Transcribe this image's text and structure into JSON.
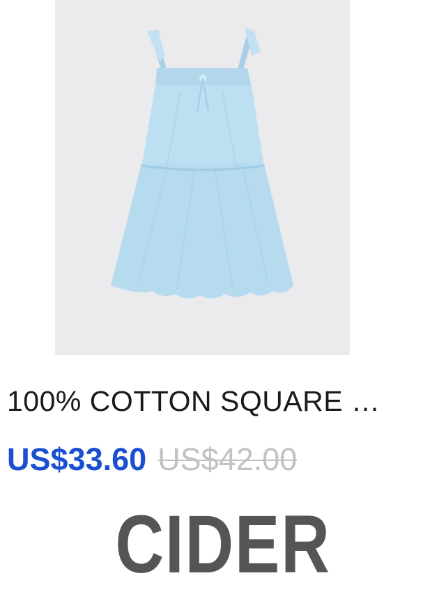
{
  "product": {
    "image_alt": "light blue tiered cotton square neck dress with tie straps",
    "title": "100% COTTON SQUARE …",
    "price_current": "US$33.60",
    "price_original": "US$42.00",
    "brand": "CIDER"
  },
  "colors": {
    "image_background": "#ebebed",
    "dress": "#b9dcef",
    "price_current": "#1b4fd1",
    "price_original": "#c2c2c2",
    "brand": "#555555"
  }
}
